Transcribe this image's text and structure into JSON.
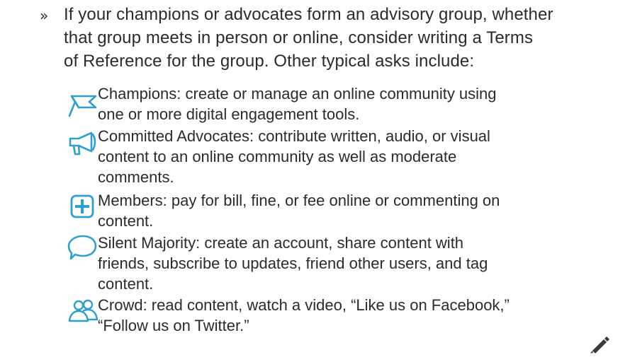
{
  "bullet": "»",
  "intro": {
    "lines": [
      "If your champions or advocates form an advisory group, whether",
      "that group meets in person or online, consider writing a Terms",
      "of Reference for the group. Other typical asks include:"
    ]
  },
  "items": [
    {
      "icon": "flag-icon",
      "lines": [
        "Champions: create or manage an online community using",
        "one or more digital engagement tools."
      ]
    },
    {
      "icon": "megaphone-icon",
      "lines": [
        "Committed Advocates: contribute written, audio, or visual",
        "content to an online community as well as moderate",
        "comments."
      ]
    },
    {
      "icon": "plus-box-icon",
      "lines": [
        "Members: pay for bill, fine, or fee online or commenting on",
        "content."
      ]
    },
    {
      "icon": "speech-bubble-icon",
      "lines": [
        "Silent Majority: create an account, share content with",
        "friends, subscribe to updates, friend other users, and tag",
        "content."
      ]
    },
    {
      "icon": "group-icon",
      "lines": [
        "Crowd: read content, watch a video, “Like us on Facebook,”",
        "“Follow us on Twitter.”"
      ]
    }
  ],
  "colors": {
    "icon": "#2f9fd0",
    "text": "#2b2b2b",
    "pencil": "#3a3a3a"
  },
  "decor": {
    "pencil": "pencil-icon"
  }
}
